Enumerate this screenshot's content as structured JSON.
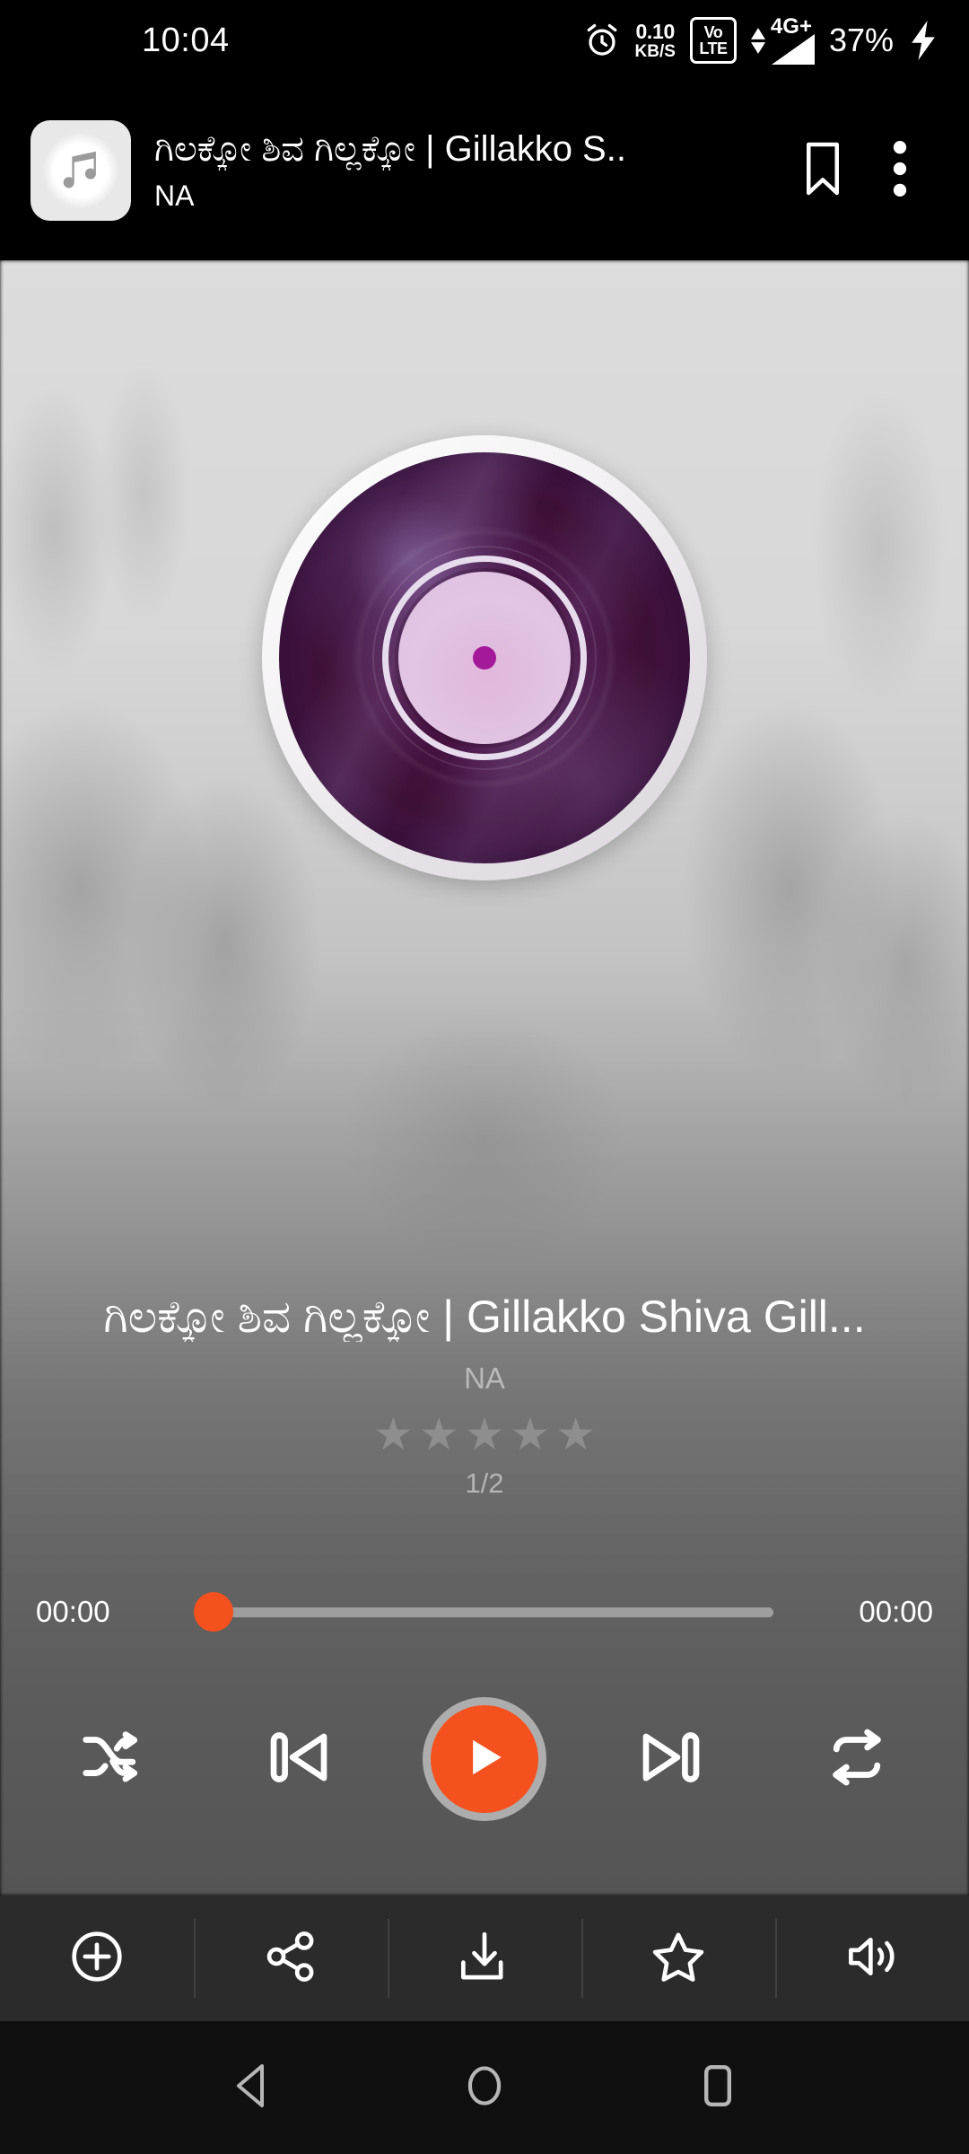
{
  "status_bar": {
    "clock": "10:04",
    "alarm_icon": "alarm-clock-icon",
    "network_speed_value": "0.10",
    "network_speed_unit": "KB/S",
    "volte_top": "Vo",
    "volte_bottom": "LTE",
    "network_type": "4G+",
    "battery_percent": "37%",
    "charging_icon": "lightning-bolt-icon"
  },
  "app_bar": {
    "thumbnail_icon": "music-note-icon",
    "title": "ಗಿಲಕ್ಕೋ ಶಿವ ಗಿಲ್ಲಕ್ಕೋ | Gillakko S..",
    "subtitle": "NA",
    "bookmark_icon": "bookmark-icon",
    "overflow_icon": "more-vertical-icon"
  },
  "player": {
    "artwork": {
      "type": "vinyl-record",
      "disc_color": "#451240",
      "rim_color": "#f3f1f3",
      "label_color": "#e0bcdf",
      "hole_color": "#a4199a"
    },
    "song_title": "ಗಿಲಕ್ಕೋ ಶಿವ ಗಿಲ್ಲಕ್ಕೋ | Gillakko Shiva Gill...",
    "artist": "NA",
    "rating": {
      "stars_total": 5,
      "stars_filled": 0,
      "star_glyph": "★",
      "star_color": "#8e8e8e"
    },
    "track_counter": "1/2",
    "seek": {
      "elapsed": "00:00",
      "duration": "00:00",
      "progress_percent": 0,
      "thumb_color": "#F4511E",
      "track_color": "#9e9e9e"
    },
    "controls": [
      {
        "name": "shuffle-button",
        "icon": "shuffle-icon"
      },
      {
        "name": "previous-button",
        "icon": "skip-previous-icon"
      },
      {
        "name": "play-button",
        "icon": "play-icon",
        "accent_color": "#F4511E",
        "ring_color": "#adadad"
      },
      {
        "name": "next-button",
        "icon": "skip-next-icon"
      },
      {
        "name": "repeat-button",
        "icon": "repeat-icon"
      }
    ]
  },
  "action_bar": [
    {
      "name": "add-to-playlist-button",
      "icon": "plus-circle-icon"
    },
    {
      "name": "share-button",
      "icon": "share-icon"
    },
    {
      "name": "download-button",
      "icon": "download-icon"
    },
    {
      "name": "favorite-button",
      "icon": "star-outline-icon"
    },
    {
      "name": "volume-button",
      "icon": "volume-up-icon"
    }
  ],
  "nav_bar": [
    {
      "name": "nav-back-button",
      "icon": "triangle-back-icon"
    },
    {
      "name": "nav-home-button",
      "icon": "circle-home-icon"
    },
    {
      "name": "nav-recents-button",
      "icon": "square-recents-icon"
    }
  ]
}
